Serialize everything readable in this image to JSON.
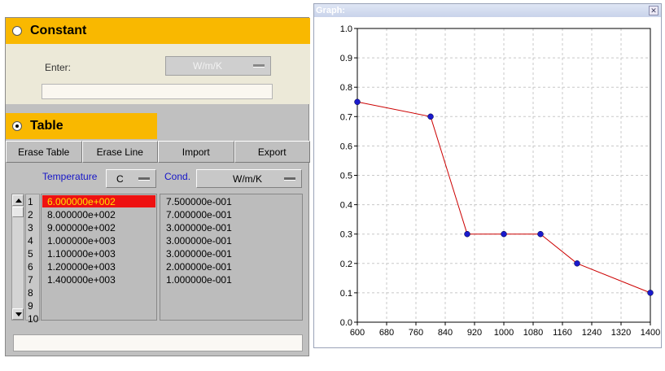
{
  "constant": {
    "label": "Constant",
    "enter_label": "Enter:",
    "unit": "W/m/K",
    "value": ""
  },
  "table_section": {
    "label": "Table"
  },
  "toolbar": {
    "erase_table": "Erase Table",
    "erase_line": "Erase Line",
    "import": "Import",
    "export": "Export"
  },
  "columns": {
    "temperature_label": "Temperature",
    "temperature_unit": "C",
    "cond_label": "Cond.",
    "cond_unit": "W/m/K"
  },
  "rows": [
    {
      "index": "1",
      "temperature": "6.000000e+002",
      "cond": "7.500000e-001"
    },
    {
      "index": "2",
      "temperature": "8.000000e+002",
      "cond": "7.000000e-001"
    },
    {
      "index": "3",
      "temperature": "9.000000e+002",
      "cond": "3.000000e-001"
    },
    {
      "index": "4",
      "temperature": "1.000000e+003",
      "cond": "3.000000e-001"
    },
    {
      "index": "5",
      "temperature": "1.100000e+003",
      "cond": "3.000000e-001"
    },
    {
      "index": "6",
      "temperature": "1.200000e+003",
      "cond": "2.000000e-001"
    },
    {
      "index": "7",
      "temperature": "1.400000e+003",
      "cond": "1.000000e-001"
    },
    {
      "index": "8",
      "temperature": "",
      "cond": ""
    },
    {
      "index": "9",
      "temperature": "",
      "cond": ""
    },
    {
      "index": "10",
      "temperature": "",
      "cond": ""
    }
  ],
  "selected_row": 0,
  "status_value": "",
  "graph_window": {
    "title": "Graph:",
    "close_glyph": "✕"
  },
  "chart_data": {
    "type": "line",
    "x": [
      600,
      800,
      900,
      1000,
      1100,
      1200,
      1400
    ],
    "y": [
      0.75,
      0.7,
      0.3,
      0.3,
      0.3,
      0.2,
      0.1
    ],
    "xlim": [
      600,
      1400
    ],
    "ylim": [
      0.0,
      1.0
    ],
    "x_ticks": [
      600,
      680,
      760,
      840,
      920,
      1000,
      1080,
      1160,
      1240,
      1320,
      1400
    ],
    "y_ticks": [
      0.0,
      0.1,
      0.2,
      0.3,
      0.4,
      0.5,
      0.6,
      0.7,
      0.8,
      0.9,
      1.0
    ],
    "grid": true,
    "line_color": "#cc0000",
    "marker_color": "#1a1acc"
  },
  "colors": {
    "section_header": "#f9b800",
    "panel": "#c0c0c0",
    "selected_cell": "#ee1111",
    "column_label": "#1515c8"
  },
  "icons": {
    "radio_unchecked": "radio-unchecked-icon",
    "radio_checked": "radio-checked-icon",
    "dropdown": "dropdown-arrow-icon",
    "close": "close-icon"
  }
}
